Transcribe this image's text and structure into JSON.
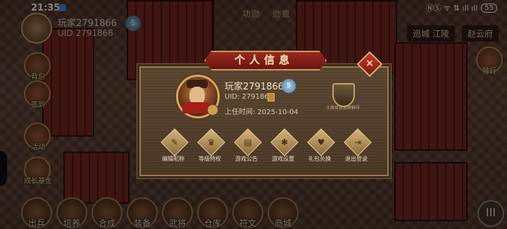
{
  "status_bar": {
    "time": "21:35",
    "icons": "ⓃⓈ ᯤ ⇅ ıll ıll",
    "battery": "55"
  },
  "player_header": {
    "name": "玩家2791866",
    "uid": "UID  2791866",
    "level": "5"
  },
  "top_labels": [
    "功勋",
    "勋章"
  ],
  "top_right": [
    "巡城 江陵",
    "赵云府"
  ],
  "left_menu": [
    "背包",
    "签到",
    "活动",
    "成长基金"
  ],
  "right_menu": [
    "排行"
  ],
  "bottom_bar": [
    "出兵",
    "培养",
    "合成",
    "装备",
    "武将",
    "仓库",
    "符文",
    "商城"
  ],
  "modal": {
    "title": "个人信息",
    "close_icon": "×",
    "player_name": "玩家2791866",
    "level": "5",
    "uid": "UID: 2791866",
    "start_time": "上任时间: 2025-10-04",
    "emblem_text": "士族官员武将称号",
    "actions": [
      {
        "icon": "brush-icon",
        "glyph": "✎",
        "label": "编辑昵称"
      },
      {
        "icon": "crown-icon",
        "glyph": "♛",
        "label": "等级特权"
      },
      {
        "icon": "notice-icon",
        "glyph": "▤",
        "label": "游戏公告"
      },
      {
        "icon": "gear-icon",
        "glyph": "✱",
        "label": "游戏设置"
      },
      {
        "icon": "gift-icon",
        "glyph": "♥",
        "label": "礼包兑换"
      },
      {
        "icon": "logout-icon",
        "glyph": "⇥",
        "label": "退出登录"
      }
    ]
  },
  "menu_button": "III"
}
